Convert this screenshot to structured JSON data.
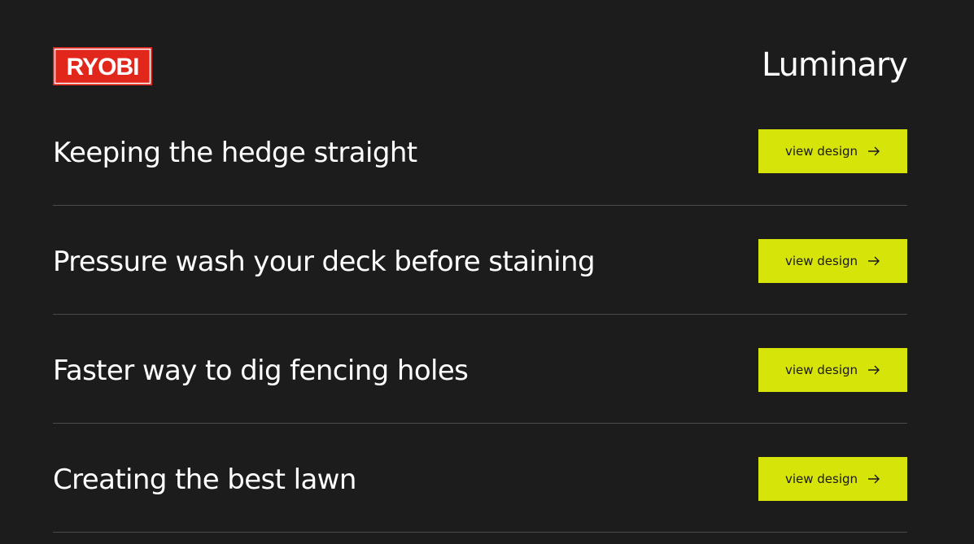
{
  "header": {
    "logo_text": "RYOBI",
    "brand": "Luminary"
  },
  "rows": [
    {
      "title": "Keeping the hedge straight",
      "button_label": "view design"
    },
    {
      "title": "Pressure wash your deck before staining",
      "button_label": "view design"
    },
    {
      "title": "Faster way to dig fencing holes",
      "button_label": "view design"
    },
    {
      "title": "Creating the best lawn",
      "button_label": "view design"
    }
  ],
  "icons": {
    "button_icon": "arrow-right-icon"
  },
  "colors": {
    "background": "#1c1c1c",
    "logo_red": "#e1261c",
    "button": "#d7e40a",
    "divider": "#4a4a4a"
  }
}
